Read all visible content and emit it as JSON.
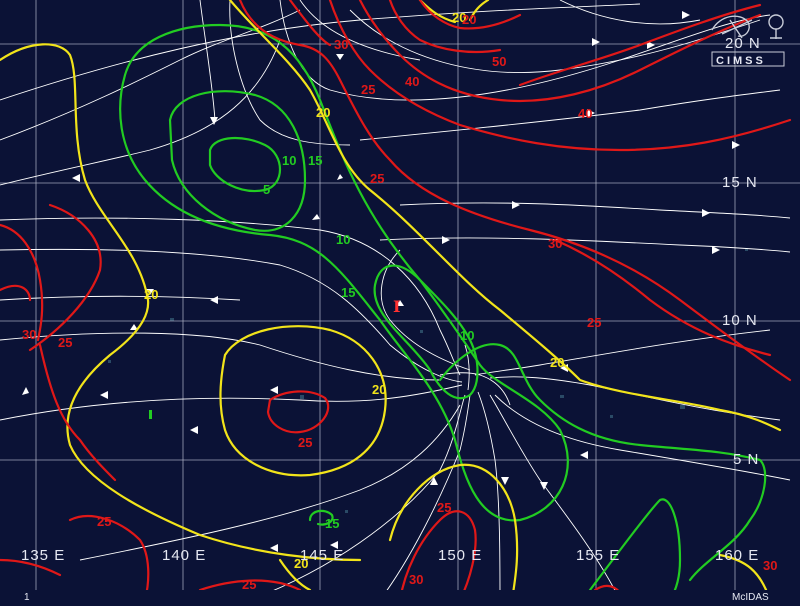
{
  "map": {
    "colors": {
      "background": "#0b1236",
      "grid": "#b8bcd0",
      "streamline": "#ffffff",
      "shear_5_15": "#22cc22",
      "shear_20": "#f2e41a",
      "shear_25_plus": "#e01818",
      "storm_marker": "#ff3030"
    },
    "lon_labels": [
      "135 E",
      "140 E",
      "145 E",
      "150 E",
      "155 E",
      "160 E"
    ],
    "lat_labels": [
      "20 N",
      "15 N",
      "10 N",
      "5 N"
    ],
    "contour_labels": {
      "green": [
        "5",
        "10",
        "15",
        "10",
        "15",
        "10",
        "15"
      ],
      "yellow": [
        "20",
        "20",
        "20",
        "20",
        "20",
        "20"
      ],
      "red": [
        "20",
        "25",
        "30",
        "40",
        "50",
        "40",
        "25",
        "30",
        "25",
        "30",
        "25",
        "25",
        "25",
        "25",
        "30",
        "25",
        "30"
      ]
    },
    "storm_symbol": "I",
    "footer_left": "1",
    "footer_right": "McIDAS",
    "logo_text": "CIMSS",
    "logo_icons": [
      "satellite-logo-icon"
    ]
  }
}
